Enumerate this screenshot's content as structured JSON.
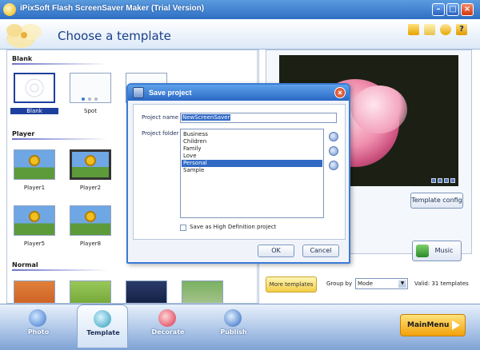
{
  "window": {
    "title": "iPixSoft Flash ScreenSaver Maker (Trial Version)"
  },
  "header": {
    "heading": "Choose a template"
  },
  "templates": {
    "sections": [
      {
        "title": "Blank",
        "items": [
          {
            "label": "Blank",
            "selected": true
          },
          {
            "label": "Spot"
          }
        ]
      },
      {
        "title": "Player",
        "items": [
          {
            "label": "Player1"
          },
          {
            "label": "Player2"
          },
          {
            "label": "Player5"
          },
          {
            "label": "Player8"
          }
        ]
      },
      {
        "title": "Normal",
        "items": []
      }
    ]
  },
  "preview": {
    "template_config_label": "Template config",
    "music_label": "Music"
  },
  "bottom_strip": {
    "more_templates_label": "More templates",
    "group_by_label": "Group by",
    "group_by_value": "Mode",
    "valid_text": "Valid: 31 templates"
  },
  "nav": {
    "tabs": [
      {
        "label": "Photo"
      },
      {
        "label": "Template"
      },
      {
        "label": "Decorate"
      },
      {
        "label": "Publish"
      }
    ],
    "main_menu_label": "MainMenu"
  },
  "dialog": {
    "title": "Save project",
    "project_name_label": "Project name",
    "project_name_value": "NewScreenSaver",
    "project_folder_label": "Project folder",
    "folders": [
      "Business",
      "Children",
      "Family",
      "Love",
      "Personal",
      "Sample"
    ],
    "selected_folder": "Personal",
    "hd_label": "Save as High Definition project",
    "ok_label": "OK",
    "cancel_label": "Cancel"
  },
  "colors": {
    "accent": "#316ac5",
    "title_bar": "#2f6fc4",
    "main_menu": "#f2a10a"
  }
}
